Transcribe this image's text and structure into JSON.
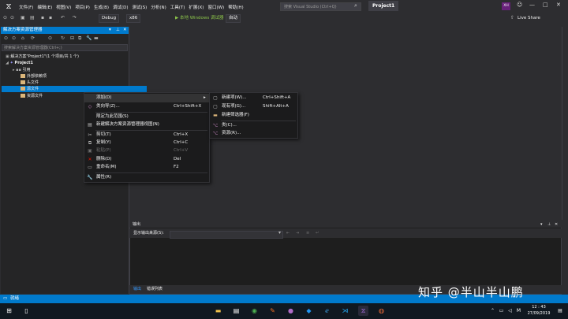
{
  "menubar": {
    "items": [
      "文件(F)",
      "编辑(E)",
      "视图(V)",
      "项目(P)",
      "生成(B)",
      "调试(D)",
      "测试(S)",
      "分析(N)",
      "工具(T)",
      "扩展(X)",
      "窗口(W)",
      "帮助(H)"
    ],
    "search_placeholder": "搜索 Visual Studio (Ctrl+Q)",
    "project_title": "Project1",
    "user_initials": "XH"
  },
  "toolbar": {
    "config": "Debug",
    "platform": "x86",
    "run_label": "▶ 本地 Windows 调试器",
    "run_mode": "自动",
    "live_share": "Live Share"
  },
  "solution_explorer": {
    "title": "解决方案资源管理器",
    "search_placeholder": "搜索解决方案资源管理器(Ctrl+;)",
    "tree": [
      {
        "label": "解决方案\"Project1\"(1 个项目/共 1 个)",
        "indent": 0
      },
      {
        "label": "Project1",
        "indent": 1
      },
      {
        "label": "引用",
        "indent": 2
      },
      {
        "label": "外部依赖项",
        "indent": 2
      },
      {
        "label": "头文件",
        "indent": 2
      },
      {
        "label": "源文件",
        "indent": 2
      },
      {
        "label": "资源文件",
        "indent": 2
      }
    ]
  },
  "context_menu": {
    "items": [
      {
        "label": "添加(D)",
        "shortcut": "",
        "icon": "",
        "submenu": "▸"
      },
      {
        "label": "类向导(Z)...",
        "shortcut": "Ctrl+Shift+X",
        "icon": "◇"
      },
      {
        "label": "限定为此范围(S)",
        "shortcut": "",
        "icon": ""
      },
      {
        "label": "新建解决方案资源管理器视图(N)",
        "shortcut": "",
        "icon": "▤"
      },
      {
        "label": "剪切(T)",
        "shortcut": "Ctrl+X",
        "icon": "✂"
      },
      {
        "label": "复制(Y)",
        "shortcut": "Ctrl+C",
        "icon": "⧉"
      },
      {
        "label": "粘贴(P)",
        "shortcut": "Ctrl+V",
        "icon": "▣"
      },
      {
        "label": "删除(D)",
        "shortcut": "Del",
        "icon": "✕"
      },
      {
        "label": "重命名(M)",
        "shortcut": "F2",
        "icon": "▭"
      },
      {
        "label": "属性(R)",
        "shortcut": "",
        "icon": "🔧"
      }
    ]
  },
  "submenu": {
    "items": [
      {
        "label": "新建项(W)...",
        "shortcut": "Ctrl+Shift+A",
        "icon": "▢"
      },
      {
        "label": "现有项(G)...",
        "shortcut": "Shift+Alt+A",
        "icon": "▢"
      },
      {
        "label": "新建筛选器(F)",
        "shortcut": "",
        "icon": "▬"
      },
      {
        "label": "类(C)...",
        "shortcut": "",
        "icon": "⌥"
      },
      {
        "label": "资源(R)...",
        "shortcut": "",
        "icon": "⌥"
      }
    ]
  },
  "output": {
    "title": "输出",
    "source_label": "显示输出来源(S):",
    "tabs": [
      "输出",
      "错误列表"
    ]
  },
  "statusbar": {
    "text": "就绪"
  },
  "taskbar": {
    "time": "12 : 43",
    "date": "27/09/2019"
  },
  "watermark": "知乎 @半山半山鹏",
  "colors": {
    "accent": "#007acc",
    "background": "#2d2d30",
    "panel": "#252526",
    "menu": "#1b1b1c"
  }
}
